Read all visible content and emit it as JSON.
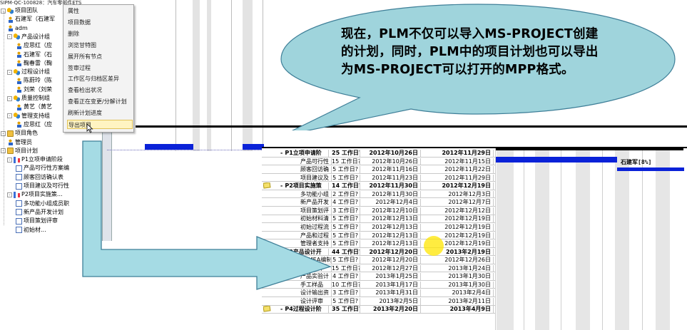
{
  "window": {
    "title": "SIPM-QC-100828：汽车零部件ETS"
  },
  "tree": {
    "nodes": [
      {
        "label": "项目团队",
        "level": 0,
        "icon": "group",
        "toggle": "-"
      },
      {
        "label": "石建军（石建军",
        "level": 1,
        "icon": "person"
      },
      {
        "label": "adm",
        "level": 1,
        "icon": "person"
      },
      {
        "label": "产品设计组",
        "level": 1,
        "icon": "group",
        "toggle": "-"
      },
      {
        "label": "应思红（应",
        "level": 2,
        "icon": "person"
      },
      {
        "label": "石建军（石",
        "level": 2,
        "icon": "person"
      },
      {
        "label": "鞠春雷（鞠",
        "level": 2,
        "icon": "person"
      },
      {
        "label": "过程设计组",
        "level": 1,
        "icon": "group",
        "toggle": "-"
      },
      {
        "label": "陈蔚玲（陈",
        "level": 2,
        "icon": "person"
      },
      {
        "label": "刘荣（刘荣",
        "level": 2,
        "icon": "person"
      },
      {
        "label": "质量控制组",
        "level": 1,
        "icon": "group",
        "toggle": "-"
      },
      {
        "label": "黄艺（黄艺",
        "level": 2,
        "icon": "person"
      },
      {
        "label": "管理支持组",
        "level": 1,
        "icon": "group",
        "toggle": "-"
      },
      {
        "label": "应思红（应",
        "level": 2,
        "icon": "person"
      },
      {
        "label": "项目角色",
        "level": 0,
        "icon": "folder",
        "toggle": "-"
      },
      {
        "label": "管理员",
        "level": 1,
        "icon": "person"
      },
      {
        "label": "项目计划",
        "level": 0,
        "icon": "folder",
        "toggle": "-"
      },
      {
        "label": "P1立项申请阶段",
        "level": 1,
        "icon": "plan",
        "toggle": "-"
      },
      {
        "label": "产品可行性方案编",
        "level": 2,
        "icon": "doc"
      },
      {
        "label": "顾客回访确认表",
        "level": 2,
        "icon": "doc"
      },
      {
        "label": "项目建议及可行性",
        "level": 2,
        "icon": "doc"
      },
      {
        "label": "P2项目实施策...",
        "level": 1,
        "icon": "plan",
        "toggle": "-"
      },
      {
        "label": "多功能小组成员职",
        "level": 2,
        "icon": "doc"
      },
      {
        "label": "新产品开发计划",
        "level": 2,
        "icon": "doc"
      },
      {
        "label": "项目策划评审",
        "level": 2,
        "icon": "doc"
      },
      {
        "label": "初始材...",
        "level": 2,
        "icon": "doc"
      }
    ]
  },
  "context_menu": {
    "items": [
      "属性",
      "项目数据",
      "删除",
      "浏览甘特图",
      "展开所有节点",
      "签审过程",
      "工作区与归档区差异",
      "查看检出状况",
      "查看正在变更/分解计划",
      "刷新计划进度",
      "导出项目"
    ],
    "highlighted": "导出项目"
  },
  "callout": {
    "text": "现在，PLM不仅可以导入MS-PROJECT创建的计划，同时，PLM中的项目计划也可以导出为MS-PROJECT可以打开的MPP格式。",
    "colors": {
      "fill": "#9fd4dc",
      "stroke": "#3f7f98"
    }
  },
  "arrow": {
    "fill": "#a5dbe4",
    "stroke": "#3f7f98"
  },
  "task_table": {
    "rows": [
      {
        "name": "P1立项申请阶",
        "duration": "25 工作日?",
        "start": "2012年10月26日",
        "end": "2012年11月29日",
        "summary": true,
        "toggle": "-"
      },
      {
        "name": "产品可行性",
        "duration": "15 工作日?",
        "start": "2012年10月26日",
        "end": "2012年11月15日"
      },
      {
        "name": "顾客回访确",
        "duration": "5 工作日?",
        "start": "2012年11月16日",
        "end": "2012年11月22日"
      },
      {
        "name": "项目建议及",
        "duration": "5 工作日?",
        "start": "2012年11月23日",
        "end": "2012年11月29日"
      },
      {
        "name": "P2项目实施策",
        "duration": "14 工作日?",
        "start": "2012年11月30日",
        "end": "2012年12月19日",
        "summary": true,
        "toggle": "-",
        "note": true
      },
      {
        "name": "多功能小组",
        "duration": "2 工作日?",
        "start": "2012年11月30日",
        "end": "2012年12月3日"
      },
      {
        "name": "新产品开发",
        "duration": "4 工作日?",
        "start": "2012年12月4日",
        "end": "2012年12月7日"
      },
      {
        "name": "项目策划评",
        "duration": "3 工作日?",
        "start": "2012年12月10日",
        "end": "2012年12月12日"
      },
      {
        "name": "初始材料清",
        "duration": "5 工作日?",
        "start": "2012年12月13日",
        "end": "2012年12月19日"
      },
      {
        "name": "初始过程流",
        "duration": "5 工作日?",
        "start": "2012年12月13日",
        "end": "2012年12月19日"
      },
      {
        "name": "产品和过程",
        "duration": "5 工作日?",
        "start": "2012年12月13日",
        "end": "2012年12月19日"
      },
      {
        "name": "管理者支持",
        "duration": "5 工作日?",
        "start": "2012年12月13日",
        "end": "2012年12月19日"
      },
      {
        "name": "P3产品设计开",
        "duration": "44 工作日?",
        "start": "2012年12月20日",
        "end": "2013年2月19日",
        "summary": true,
        "toggle": "-"
      },
      {
        "name": "DFMEA编制",
        "duration": "5 工作日?",
        "start": "2012年12月20日",
        "end": "2012年12月26日"
      },
      {
        "name": "图纸设计",
        "duration": "15 工作日?",
        "start": "2012年12月27日",
        "end": "2013年1月24日"
      },
      {
        "name": "产品实验计",
        "duration": "4 工作日?",
        "start": "2013年1月25日",
        "end": "2013年1月30日"
      },
      {
        "name": "手工样品",
        "duration": "10 工作日?",
        "start": "2013年1月17日",
        "end": "2013年1月30日"
      },
      {
        "name": "设计输出资",
        "duration": "3 工作日?",
        "start": "2013年1月31日",
        "end": "2013年2月4日"
      },
      {
        "name": "设计评审",
        "duration": "5 工作日?",
        "start": "2013年2月5日",
        "end": "2013年2月11日"
      },
      {
        "name": "P4过程设计阶",
        "duration": "35 工作日?",
        "start": "2013年2月20日",
        "end": "2013年4月9日",
        "summary": true,
        "toggle": "-",
        "note": true
      }
    ]
  },
  "gantt": {
    "bar_label": "石建军[8%]",
    "bar_color": "#0a22d8"
  }
}
